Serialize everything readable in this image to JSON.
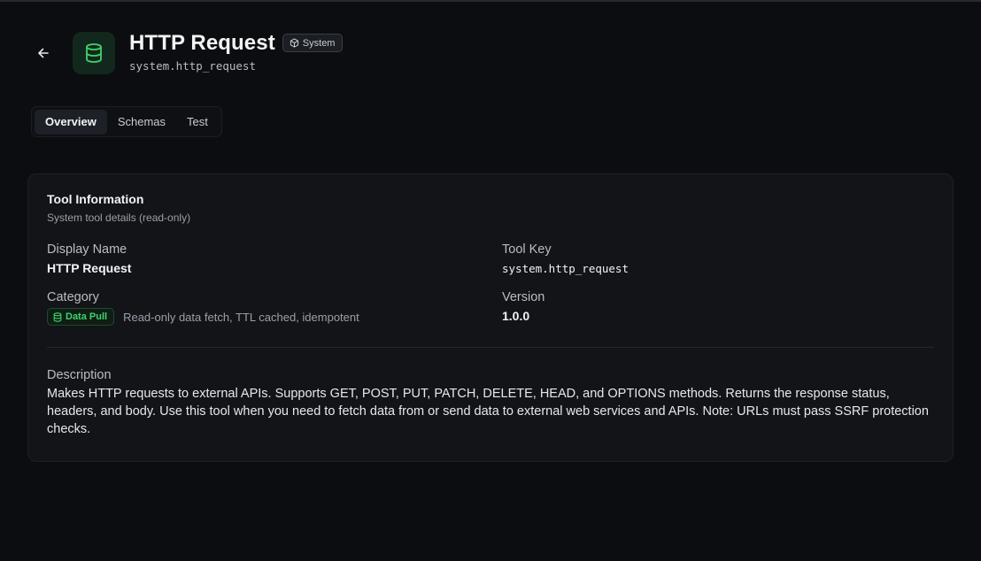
{
  "header": {
    "title": "HTTP Request",
    "badge": "System",
    "tool_key": "system.http_request",
    "icon": "database-icon",
    "accent": "#3fd36a"
  },
  "tabs": [
    {
      "label": "Overview",
      "active": true
    },
    {
      "label": "Schemas",
      "active": false
    },
    {
      "label": "Test",
      "active": false
    }
  ],
  "card": {
    "title": "Tool Information",
    "subtitle": "System tool details (read-only)",
    "display_name_label": "Display Name",
    "display_name": "HTTP Request",
    "tool_key_label": "Tool Key",
    "tool_key": "system.http_request",
    "category_label": "Category",
    "category_badge": "Data Pull",
    "category_desc": "Read-only data fetch, TTL cached, idempotent",
    "version_label": "Version",
    "version": "1.0.0",
    "description_label": "Description",
    "description": "Makes HTTP requests to external APIs. Supports GET, POST, PUT, PATCH, DELETE, HEAD, and OPTIONS methods. Returns the response status, headers, and body. Use this tool when you need to fetch data from or send data to external web services and APIs. Note: URLs must pass SSRF protection checks."
  }
}
